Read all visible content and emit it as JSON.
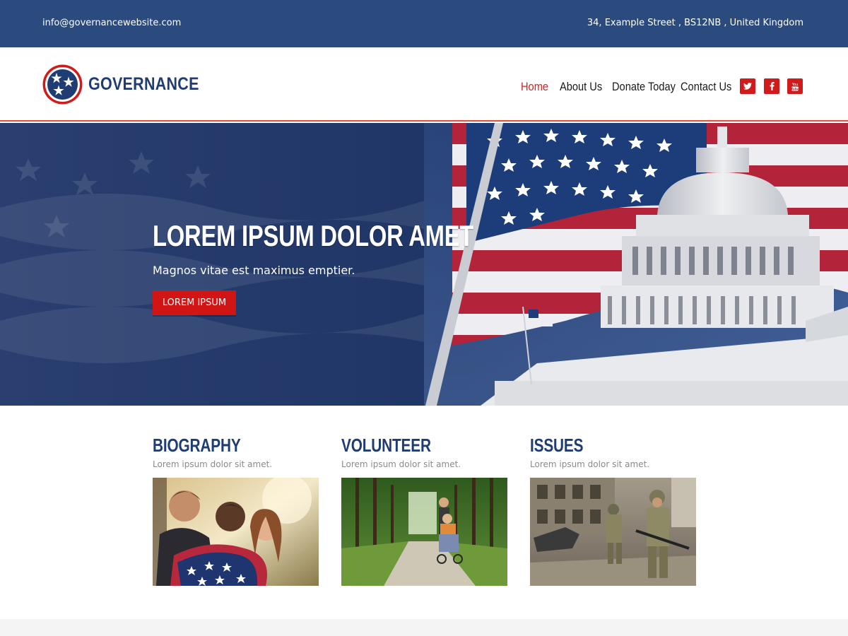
{
  "topbar": {
    "email": "info@governancewebsite.com",
    "address": "34, Example Street ,  BS12NB ,  United Kingdom"
  },
  "header": {
    "brand": "GOVERNANCE",
    "nav": [
      {
        "label": "Home",
        "active": true
      },
      {
        "label": "About Us",
        "active": false
      },
      {
        "label": "Donate Today",
        "active": false
      },
      {
        "label": "Contact Us",
        "active": false
      }
    ],
    "social": [
      {
        "icon": "twitter-icon"
      },
      {
        "icon": "facebook-icon"
      },
      {
        "icon": "youtube-icon"
      }
    ]
  },
  "hero": {
    "title": "LOREM IPSUM DOLOR AMET",
    "subtitle": "Magnos vitae est maximus emptier.",
    "button_label": "LOREM IPSUM"
  },
  "sections": [
    {
      "title": "BIOGRAPHY",
      "text": "Lorem ipsum dolor sit amet."
    },
    {
      "title": "VOLUNTEER",
      "text": "Lorem ipsum dolor sit amet."
    },
    {
      "title": "ISSUES",
      "text": "Lorem ipsum dolor sit amet."
    }
  ],
  "colors": {
    "topbar": "#2b4a7e",
    "brand_blue": "#1f3c73",
    "accent_red": "#d11414",
    "nav_active": "#d12323"
  }
}
